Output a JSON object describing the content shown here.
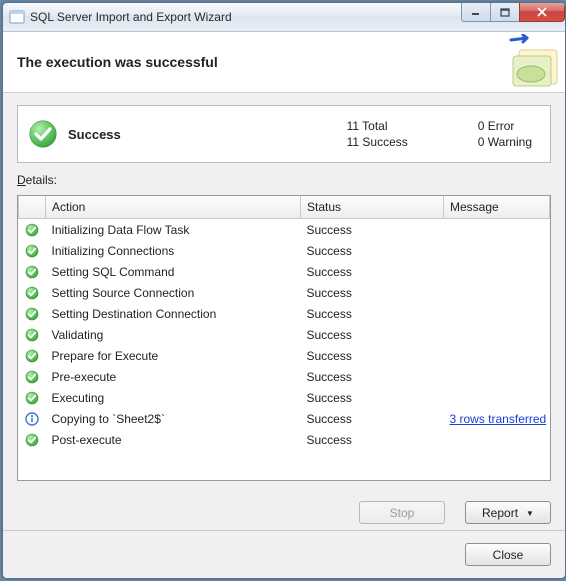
{
  "window": {
    "title": "SQL Server Import and Export Wizard"
  },
  "header": {
    "heading": "The execution was successful"
  },
  "summary": {
    "status": "Success",
    "counts": {
      "total_label": "11 Total",
      "success_label": "11 Success",
      "error_label": "0 Error",
      "warning_label": "0 Warning"
    }
  },
  "details_label_underlined": "D",
  "details_label_rest": "etails:",
  "columns": {
    "action": "Action",
    "status": "Status",
    "message": "Message"
  },
  "rows": [
    {
      "icon": "success",
      "action": "Initializing Data Flow Task",
      "status": "Success",
      "message": ""
    },
    {
      "icon": "success",
      "action": "Initializing Connections",
      "status": "Success",
      "message": ""
    },
    {
      "icon": "success",
      "action": "Setting SQL Command",
      "status": "Success",
      "message": ""
    },
    {
      "icon": "success",
      "action": "Setting Source Connection",
      "status": "Success",
      "message": ""
    },
    {
      "icon": "success",
      "action": "Setting Destination Connection",
      "status": "Success",
      "message": ""
    },
    {
      "icon": "success",
      "action": "Validating",
      "status": "Success",
      "message": ""
    },
    {
      "icon": "success",
      "action": "Prepare for Execute",
      "status": "Success",
      "message": ""
    },
    {
      "icon": "success",
      "action": "Pre-execute",
      "status": "Success",
      "message": ""
    },
    {
      "icon": "success",
      "action": "Executing",
      "status": "Success",
      "message": ""
    },
    {
      "icon": "info",
      "action": "Copying to `Sheet2$`",
      "status": "Success",
      "message": "3 rows transferred",
      "link": true
    },
    {
      "icon": "success",
      "action": "Post-execute",
      "status": "Success",
      "message": ""
    }
  ],
  "buttons": {
    "stop": "Stop",
    "report": "Report",
    "close": "Close"
  }
}
